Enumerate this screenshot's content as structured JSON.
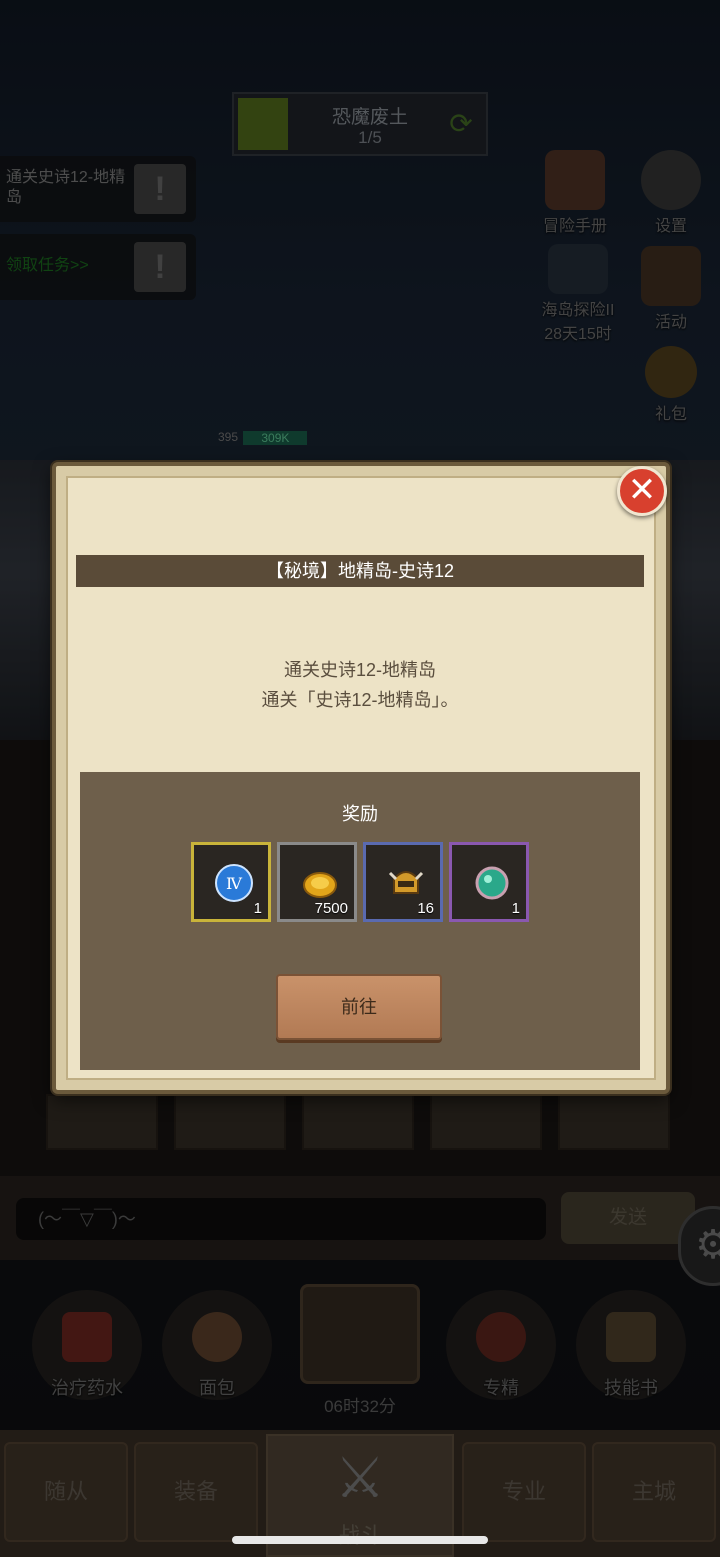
{
  "stage": {
    "title": "恐魔废土",
    "progress": "1/5"
  },
  "quests": [
    {
      "text": "通关史诗12-地精岛"
    },
    {
      "text": "领取任务>>"
    }
  ],
  "side_menu": {
    "adventure_manual": "冒险手册",
    "settings": "设置",
    "island_event": "海岛探险II",
    "island_timer": "28天15时",
    "activity": "活动",
    "gift_pack": "礼包"
  },
  "enemy": {
    "level": "395",
    "hp": "309K"
  },
  "popup": {
    "banner": "【秘境】地精岛-史诗12",
    "desc_line1": "通关史诗12-地精岛",
    "desc_line2": "通关「史诗12-地精岛」。",
    "reward_title": "奖励",
    "rewards": [
      {
        "icon": "rune-iv-icon",
        "count": "1",
        "border": "#c9b43a"
      },
      {
        "icon": "gold-coin-icon",
        "count": "7500",
        "border": "#8a8a8a"
      },
      {
        "icon": "helmet-icon",
        "count": "16",
        "border": "#5a6ab0"
      },
      {
        "icon": "gem-orb-icon",
        "count": "1",
        "border": "#8a58b0"
      }
    ],
    "go_button": "前往"
  },
  "chat": {
    "placeholder": "(～￣▽￣)～",
    "send": "发送"
  },
  "consumables": {
    "potion": "治疗药水",
    "bread": "面包",
    "chest_timer": "06时32分",
    "specialize": "专精",
    "skill_book": "技能书"
  },
  "nav": {
    "followers": "随从",
    "equipment": "装备",
    "battle": "战斗",
    "profession": "专业",
    "main_city": "主城"
  }
}
